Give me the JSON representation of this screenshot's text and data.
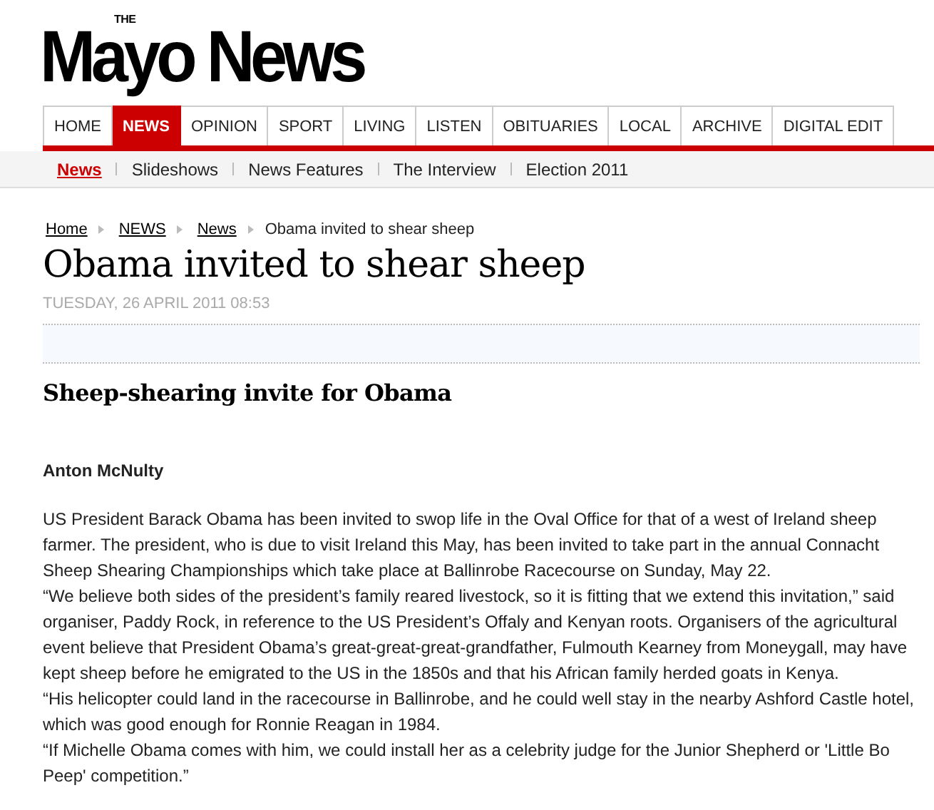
{
  "logo": {
    "small": "THE",
    "main": "Mayo News"
  },
  "nav": [
    {
      "label": "HOME",
      "selected": false
    },
    {
      "label": "NEWS",
      "selected": true
    },
    {
      "label": "OPINION",
      "selected": false
    },
    {
      "label": "SPORT",
      "selected": false
    },
    {
      "label": "LIVING",
      "selected": false
    },
    {
      "label": "LISTEN",
      "selected": false
    },
    {
      "label": "OBITUARIES",
      "selected": false
    },
    {
      "label": "LOCAL",
      "selected": false
    },
    {
      "label": "ARCHIVE",
      "selected": false
    },
    {
      "label": "DIGITAL EDIT",
      "selected": false
    }
  ],
  "subnav": [
    {
      "label": "News",
      "selected": true
    },
    {
      "label": "Slideshows",
      "selected": false
    },
    {
      "label": "News Features",
      "selected": false
    },
    {
      "label": "The Interview",
      "selected": false
    },
    {
      "label": "Election 2011",
      "selected": false
    }
  ],
  "breadcrumb": [
    {
      "label": "Home",
      "kind": "link"
    },
    {
      "label": "NEWS",
      "kind": "link"
    },
    {
      "label": "News",
      "kind": "link"
    },
    {
      "label": "Obama invited to shear sheep",
      "kind": "current"
    }
  ],
  "article": {
    "title": "Obama invited to shear sheep",
    "date": "TUESDAY, 26 APRIL 2011 08:53",
    "subtitle": "Sheep-shearing invite for Obama",
    "author": "Anton McNulty",
    "paragraphs": [
      "US President Barack Obama has been invited to swop life in the Oval Office for that of a west of Ireland sheep farmer. The president, who is due to visit Ireland this May, has been invited to take part in the annual Connacht Sheep Shearing Championships which take place at Ballinrobe Racecourse on Sunday, May 22.",
      "“We believe both sides of the president’s family reared livestock, so it is fitting that we extend this invitation,” said organiser, Paddy Rock, in reference to the US President’s Offaly and Kenyan roots. Organisers of the agricultural event believe that President Obama’s great-great-great-grandfather, Fulmouth Kearney from Moneygall, may have kept sheep before he emigrated to the US in the 1850s and that his African family herded goats in Kenya.",
      "“His helicopter could land in the racecourse in Ballinrobe, and he could well stay in the nearby Ashford Castle hotel, which was good enough for Ronnie Reagan in 1984.",
      "“If Michelle Obama comes with him, we could install her as a celebrity judge for the Junior Shepherd or 'Little Bo Peep' competition.”"
    ]
  }
}
